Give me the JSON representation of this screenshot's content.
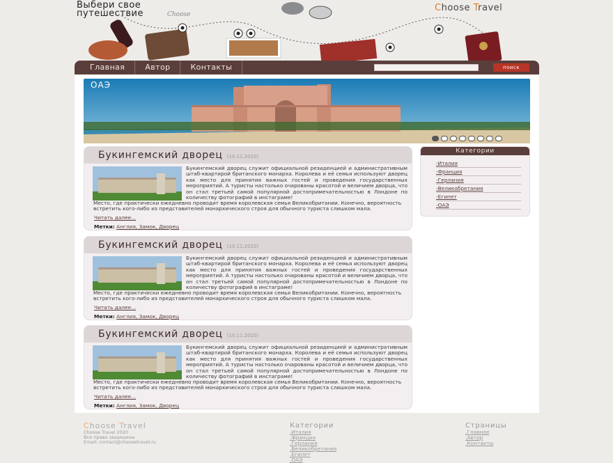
{
  "header": {
    "tagline_line1": "Выбери свое",
    "tagline_line2": "путешествие",
    "script_text": "Choose",
    "brand_part1": "C",
    "brand_part2": "hoose ",
    "brand_part3": "T",
    "brand_part4": "ravel"
  },
  "nav": {
    "items": [
      "Главная",
      "Автор",
      "Контакты"
    ],
    "search_placeholder": "",
    "search_button": "поиск"
  },
  "banner": {
    "label": "ОАЭ",
    "slides_count": 8,
    "active_slide": 1
  },
  "posts": [
    {
      "title": "Букингемский дворец",
      "date": "(10.11.2020)",
      "text1": "Букингемский дворец служит официальной резиденцией и административным штаб-квартирой британского монарха. Королева и её семья используют дворец как место для принятия важных гостей и проведения государственных мероприятий. А туристы настолько очарованы красотой и величием дворца, что он стал третьей самой популярной достопримечательностью в Лондоне по количеству фотографий в инстаграме!",
      "text2": "Место, где практически ежедневно проводит время королевская семья Великобритании. Конечно, вероятность встретить кого-либо из представителей монархического строя для обычного туриста слишком мала.",
      "read_more": "Читать далее...",
      "tags_label": "Метки:",
      "tags": "Англия, Замок, Дворец"
    },
    {
      "title": "Букингемский дворец",
      "date": "(10.11.2020)",
      "text1": "Букингемский дворец служит официальной резиденцией и административным штаб-квартирой британского монарха. Королева и её семья используют дворец как место для принятия важных гостей и проведения государственных мероприятий. А туристы настолько очарованы красотой и величием дворца, что он стал третьей самой популярной достопримечательностью в Лондоне по количеству фотографий в инстаграме!",
      "text2": "Место, где практически ежедневно проводит время королевская семья Великобритании. Конечно, вероятность встретить кого-либо из представителей монархического строя для обычного туриста слишком мала.",
      "read_more": "Читать далее...",
      "tags_label": "Метки:",
      "tags": "Англия, Замок, Дворец"
    },
    {
      "title": "Букингемский дворец",
      "date": "(10.11.2020)",
      "text1": "Букингемский дворец служит официальной резиденцией и административным штаб-квартирой британского монарха. Королева и её семья используют дворец как место для принятия важных гостей и проведения государственных мероприятий. А туристы настолько очарованы красотой и величием дворца, что он стал третьей самой популярной достопримечательностью в Лондоне по количеству фотографий в инстаграме!",
      "text2": "Место, где практически ежедневно проводит время королевская семья Великобритании. Конечно, вероятность встретить кого-либо из представителей монархического строя для обычного туриста слишком мала.",
      "read_more": "Читать далее...",
      "tags_label": "Метки:",
      "tags": "Англия, Замок, Дворец"
    }
  ],
  "sidebar": {
    "title": "Категории",
    "categories": [
      "-Италия",
      "-Франция",
      "-Герлания",
      "-Великобретания",
      "-Египет",
      "-ОАЭ"
    ]
  },
  "footer": {
    "brand_part1": "C",
    "brand_part2": "hoose ",
    "brand_part3": "T",
    "brand_part4": "ravel",
    "line1": "Choose Travel 2020",
    "line2": "Все права защищены",
    "line3": "Email: contact@choosetravel.ru",
    "categories_title": "Категории",
    "categories": [
      ".Италия",
      ".Франция",
      ".Герлания",
      ".Великобретания",
      ".Египет",
      ".ОАЭ"
    ],
    "pages_title": "Страницы",
    "pages": [
      ".Главное",
      ".Автор",
      ".Контакты"
    ]
  },
  "colors": {
    "accent": "#5a3e3b",
    "brand_orange": "#e07a24",
    "search_button": "#b83426",
    "page_bg": "#eeece9"
  }
}
